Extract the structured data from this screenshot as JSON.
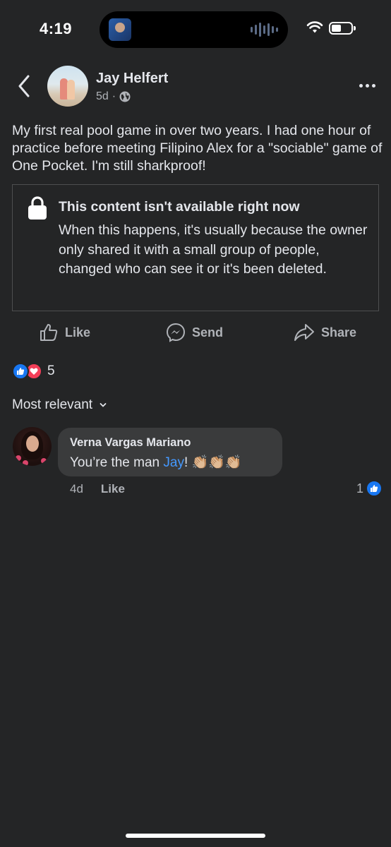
{
  "status_bar": {
    "time": "4:19"
  },
  "post": {
    "author": "Jay Helfert",
    "time_ago": "5d",
    "separator": "·",
    "privacy_icon": "globe-icon",
    "text": "My first real pool game in over two years. I had one hour of practice before meeting Filipino Alex for a \"sociable\" game of One Pocket. I'm still sharkproof!",
    "unavailable": {
      "title": "This content isn't available right now",
      "body": "When this happens, it's usually because the owner only shared it with a small group of people, changed who can see it or it's been deleted."
    },
    "actions": {
      "like": "Like",
      "send": "Send",
      "share": "Share"
    },
    "reactions": {
      "count": "5",
      "types": [
        "like",
        "love"
      ]
    }
  },
  "comments_section": {
    "sort_label": "Most relevant",
    "comments": [
      {
        "author": "Verna Vargas Mariano",
        "text_before": "You’re the man ",
        "mention": "Jay",
        "text_after": "! 👏🏼👏🏼👏🏼",
        "time_ago": "4d",
        "like_label": "Like",
        "reaction_count": "1"
      }
    ]
  },
  "colors": {
    "background": "#242526",
    "bubble": "#3a3b3c",
    "text": "#e4e6eb",
    "secondary_text": "#b0b3b8",
    "link": "#4599ff",
    "like_blue": "#1877f2",
    "love_red": "#f33e58"
  }
}
